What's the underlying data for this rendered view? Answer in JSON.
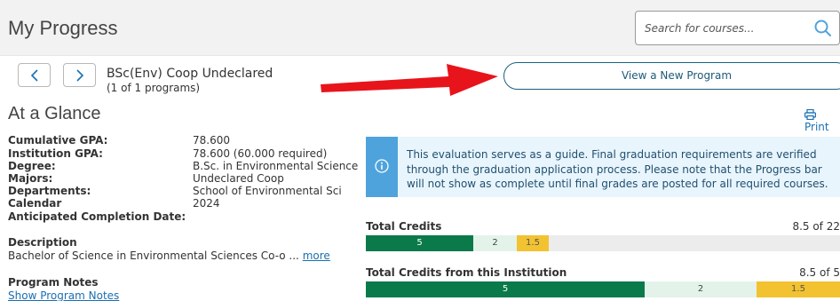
{
  "header": {
    "title": "My Progress",
    "search_placeholder": "Search for courses...",
    "search_icon": "search-icon"
  },
  "program_nav": {
    "prev_icon": "chevron-left-icon",
    "next_icon": "chevron-right-icon",
    "program_name": "BSc(Env) Coop Undeclared",
    "program_count": "(1 of 1 programs)",
    "view_new_program_label": "View a New Program"
  },
  "glance": {
    "heading": "At a Glance",
    "print_label": "Print",
    "print_icon": "printer-icon",
    "details": [
      {
        "label": "Cumulative GPA:",
        "value": "78.600"
      },
      {
        "label": "Institution GPA:",
        "value": "78.600 (60.000 required)"
      },
      {
        "label": "Degree:",
        "value": "B.Sc. in Environmental Science"
      },
      {
        "label": "Majors:",
        "value": "Undeclared Coop"
      },
      {
        "label": "Departments:",
        "value": "School of Environmental Sci"
      },
      {
        "label": "Calendar",
        "value": "2024"
      },
      {
        "label": "Anticipated Completion Date:",
        "value": ""
      }
    ],
    "description_heading": "Description",
    "description_text": "Bachelor of Science in Environmental Sciences Co-o ...",
    "description_more": "more",
    "program_notes_heading": "Program Notes",
    "program_notes_link": "Show Program Notes"
  },
  "notice": {
    "icon": "info-icon",
    "text": "This evaluation serves as a guide. Final graduation requirements are verified through the graduation application process. Please note that the Progress bar will not show as complete until final grades are posted for all required courses."
  },
  "credits": [
    {
      "label": "Total Credits",
      "summary": "8.5 of 22",
      "completed": 5,
      "in_progress": 2,
      "planned": 1.5,
      "required": 22,
      "completed_label": "5",
      "in_progress_label": "2",
      "planned_label": "1.5"
    },
    {
      "label": "Total Credits from this Institution",
      "summary": "8.5 of 5",
      "completed": 5,
      "in_progress": 2,
      "planned": 1.5,
      "required": 5,
      "completed_label": "5",
      "in_progress_label": "2",
      "planned_label": "1.5"
    }
  ],
  "colors": {
    "completed": "#0b7a4b",
    "in_progress": "#e3f3ea",
    "planned": "#f2c230",
    "link": "#1a6fb0",
    "annotation_arrow": "#e8141b"
  }
}
